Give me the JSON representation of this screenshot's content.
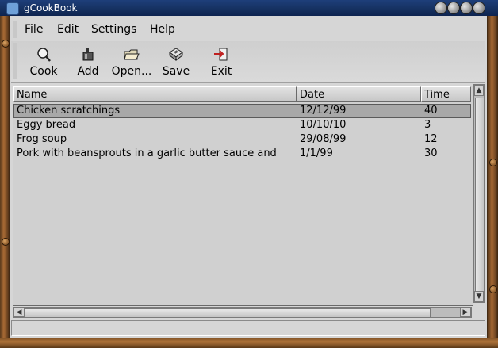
{
  "window": {
    "title": "gCookBook"
  },
  "menu": [
    "File",
    "Edit",
    "Settings",
    "Help"
  ],
  "toolbar": {
    "cook": "Cook",
    "add": "Add",
    "open": "Open...",
    "save": "Save",
    "exit": "Exit"
  },
  "columns": [
    "Name",
    "Date",
    "Time"
  ],
  "recipes": [
    {
      "name": "Chicken scratchings",
      "date": "12/12/99",
      "time": "40"
    },
    {
      "name": "Eggy bread",
      "date": "10/10/10",
      "time": "3"
    },
    {
      "name": "Frog soup",
      "date": "29/08/99",
      "time": "12"
    },
    {
      "name": "Pork with beansprouts in a garlic butter sauce and",
      "date": "1/1/99",
      "time": "30"
    }
  ],
  "selected_row": 0,
  "status": ""
}
